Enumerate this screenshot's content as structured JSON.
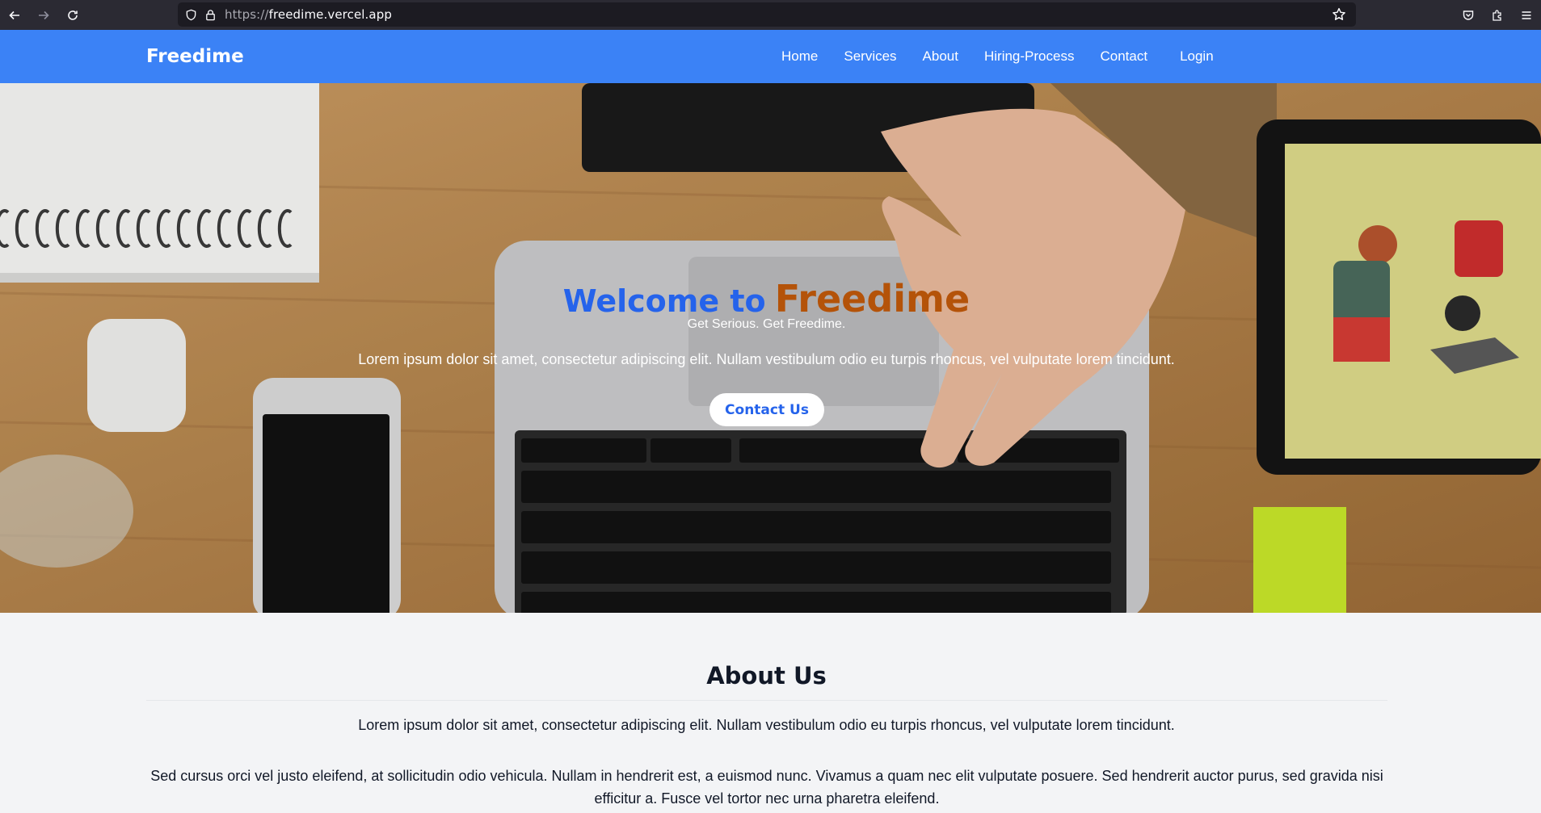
{
  "browser": {
    "url_protocol": "https://",
    "url_host": "freedime.vercel.app",
    "icons": [
      "back-icon",
      "forward-icon",
      "reload-icon",
      "shield-icon",
      "lock-icon",
      "star-icon",
      "pocket-icon",
      "extensions-icon",
      "menu-icon"
    ]
  },
  "nav": {
    "brand": "Freedime",
    "links": [
      "Home",
      "Services",
      "About",
      "Hiring-Process",
      "Contact"
    ],
    "login": "Login",
    "background": "#3b82f6"
  },
  "hero": {
    "title_prefix": "Welcome to",
    "title_brand": "Freedime",
    "tagline": "Get Serious. Get Freedime.",
    "text": "Lorem ipsum dolor sit amet, consectetur adipiscing elit. Nullam vestibulum odio eu turpis rhoncus, vel vulputate lorem tincidunt.",
    "button": "Contact Us",
    "colors": {
      "prefix": "#2563eb",
      "brand": "#b45309"
    }
  },
  "about": {
    "title": "About Us",
    "p1": "Lorem ipsum dolor sit amet, consectetur adipiscing elit. Nullam vestibulum odio eu turpis rhoncus, vel vulputate lorem tincidunt.",
    "p2": "Sed cursus orci vel justo eleifend, at sollicitudin odio vehicula. Nullam in hendrerit est, a euismod nunc. Vivamus a quam nec elit vulputate posuere. Sed hendrerit auctor purus, sed gravida nisi efficitur a. Fusce vel tortor nec urna pharetra eleifend."
  }
}
